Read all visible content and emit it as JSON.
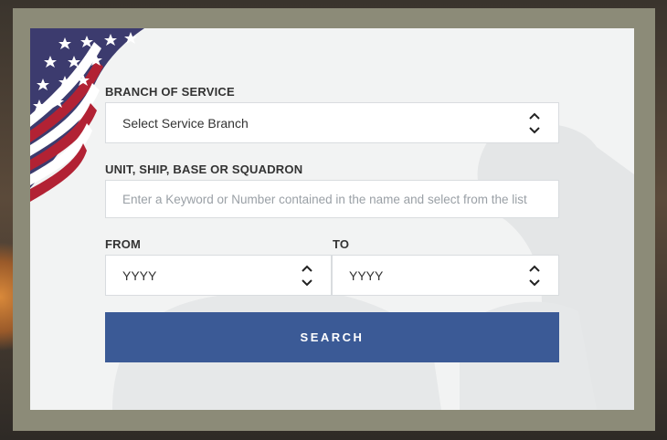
{
  "form": {
    "branch_label": "BRANCH OF SERVICE",
    "branch_value": "Select Service Branch",
    "unit_label": "UNIT, SHIP, BASE OR SQUADRON",
    "unit_placeholder": "Enter a Keyword or Number contained in the name and select from the list",
    "from_label": "FROM",
    "from_value": "YYYY",
    "to_label": "TO",
    "to_value": "YYYY",
    "search_label": "SEARCH"
  },
  "icons": {
    "select_arrows": "up-down-chevron-icon",
    "flag": "us-flag-icon"
  },
  "colors": {
    "frame": "#8c8b78",
    "panel": "#f2f3f3",
    "button": "#3b5a96",
    "flag_red": "#b22234",
    "flag_blue": "#3c3b6e"
  }
}
